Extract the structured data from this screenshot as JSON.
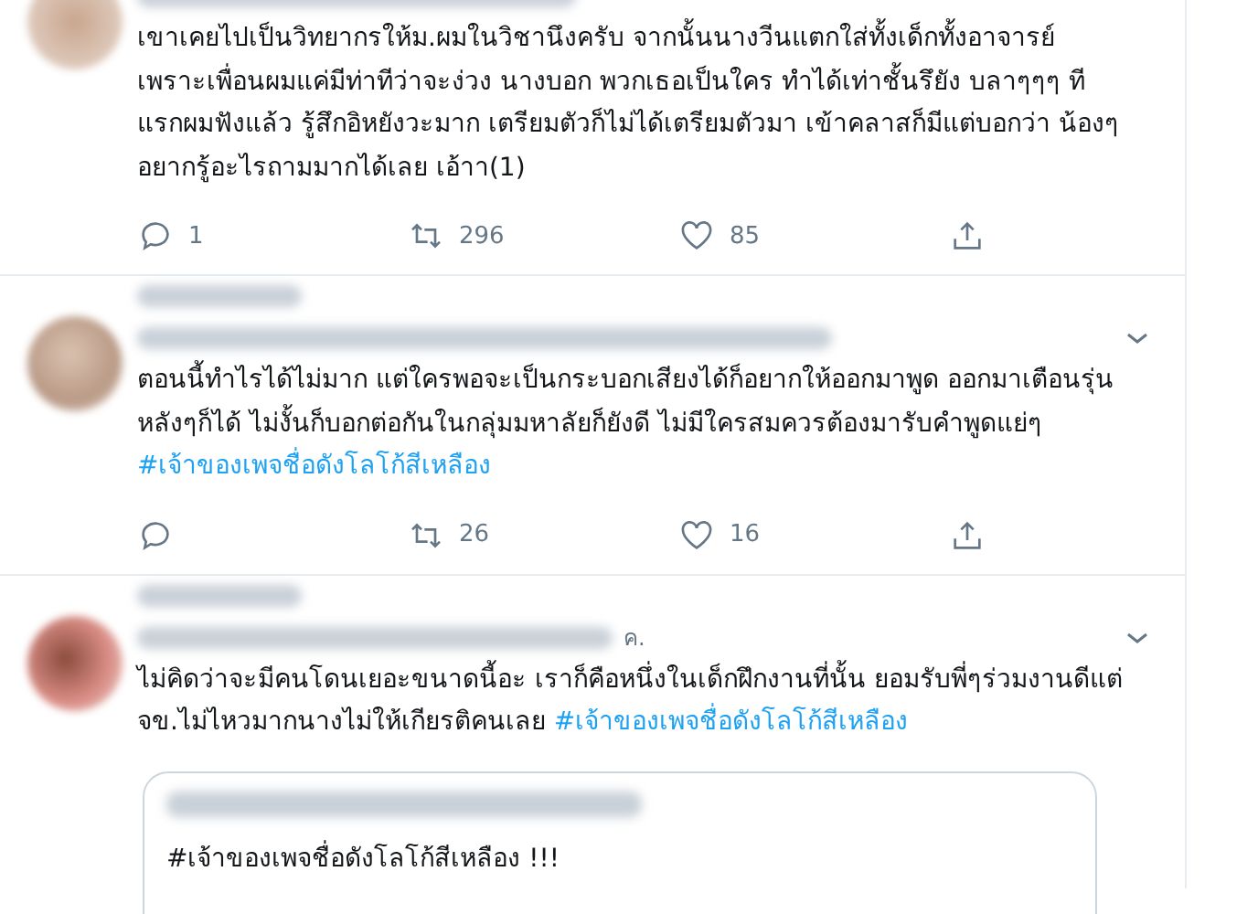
{
  "tweets": [
    {
      "kind": "cut",
      "text": "เขาเคยไปเป็นวิทยากรให้ม.ผมในวิชานึงครับ จากนั้นนางวีนแตกใส่ทั้งเด็กทั้งอาจารย์ เพราะเพื่อนผมแค่มีท่าทีว่าจะง่วง นางบอก พวกเธอเป็นใคร ทำได้เท่าชั้นรึยัง บลาๆๆๆ ทีแรกผมฟังแล้ว รู้สึกอิหยังวะมาก เตรียมตัวก็ไม่ได้เตรียมตัวมา เข้าคลาสก็มีแต่บอกว่า น้องๆอยากรู้อะไรถามมากได้เลย เอ้าา(1)",
      "actions": {
        "reply": "1",
        "retweet": "296",
        "like": "85"
      }
    },
    {
      "kind": "full",
      "text": "ตอนนี้ทำไรได้ไม่มาก แต่ใครพอจะเป็นกระบอกเสียงได้ก็อยากให้ออกมาพูด ออกมาเตือนรุ่นหลังๆก็ได้ ไม่งั้นก็บอกต่อกันในกลุ่มมหาลัยก็ยังดี ไม่มีใครสมควรต้องมารับคำพูดแย่ๆ",
      "hashtag": "#เจ้าของเพจชื่อดังโลโก้สีเหลือง",
      "actions": {
        "retweet": "26",
        "like": "16"
      }
    },
    {
      "kind": "full",
      "header_tail": "ค.",
      "text": "ไม่คิดว่าจะมีคนโดนเยอะขนาดนี้อะ เราก็คือหนึ่งในเด็กฝึกงานที่นั้น ยอมรับพี่ๆร่วมงานดีแต่ จข.ไม่ไหวมากนางไม่ให้เกียรติคนเลย",
      "hashtag": "#เจ้าของเพจชื่อดังโลโก้สีเหลือง",
      "quote": {
        "text": "#เจ้าของเพจชื่อดังโลโก้สีเหลือง !!!"
      }
    }
  ]
}
